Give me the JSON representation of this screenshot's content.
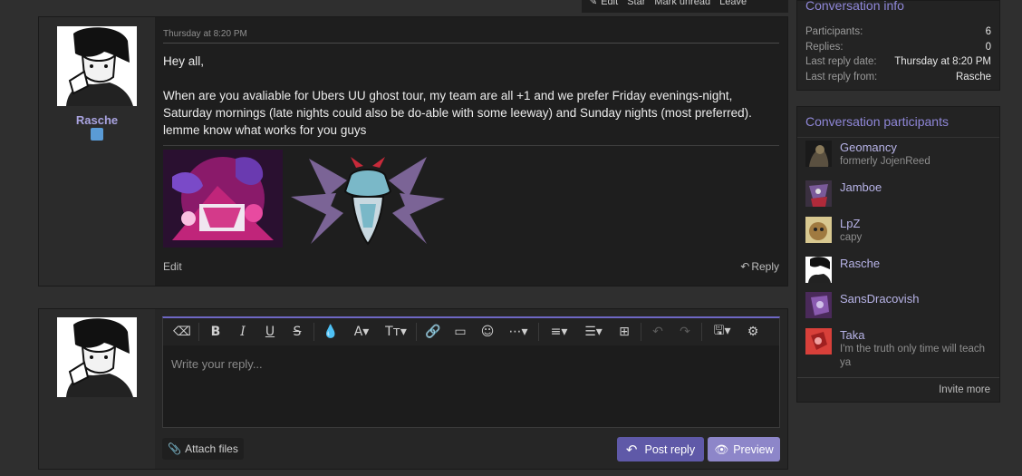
{
  "top_actions": {
    "edit": "Edit",
    "star": "Star",
    "mark_unread": "Mark unread",
    "leave": "Leave"
  },
  "message": {
    "author": "Rasche",
    "date": "Thursday at 8:20 PM",
    "greeting": "Hey all,",
    "body": "When are you avaliable for Ubers UU ghost tour, my team are all +1 and we prefer Friday evenings-night, Saturday mornings (late nights could also be do-able with some leeway) and Sunday nights (most preferred). lemme know what works for you guys",
    "edit_label": "Edit",
    "reply_label": "Reply"
  },
  "composer": {
    "placeholder": "Write your reply...",
    "attach_label": "Attach files",
    "post_label": "Post reply",
    "preview_label": "Preview"
  },
  "conversation_info": {
    "title": "Conversation info",
    "rows": [
      {
        "label": "Participants:",
        "value": "6"
      },
      {
        "label": "Replies:",
        "value": "0"
      },
      {
        "label": "Last reply date:",
        "value": "Thursday at 8:20 PM"
      },
      {
        "label": "Last reply from:",
        "value": "Rasche"
      }
    ]
  },
  "participants": {
    "title": "Conversation participants",
    "items": [
      {
        "name": "Geomancy",
        "sub": "formerly JojenReed",
        "color": "#3a3a3a"
      },
      {
        "name": "Jamboe",
        "sub": "",
        "color": "#5a4a6a"
      },
      {
        "name": "LpZ",
        "sub": "capy",
        "color": "#c9a85a"
      },
      {
        "name": "Rasche",
        "sub": "",
        "color": "#ffffff"
      },
      {
        "name": "SansDracovish",
        "sub": "",
        "color": "#6a3a8a"
      },
      {
        "name": "Taka",
        "sub": "I'm the truth only time will teach ya",
        "color": "#d13a3a"
      }
    ],
    "invite_label": "Invite more"
  },
  "colors": {
    "accent": "#8f87d8",
    "post_button": "#5f59a8",
    "preview_button": "#8d86c9",
    "editor_border": "#6e67c4"
  }
}
